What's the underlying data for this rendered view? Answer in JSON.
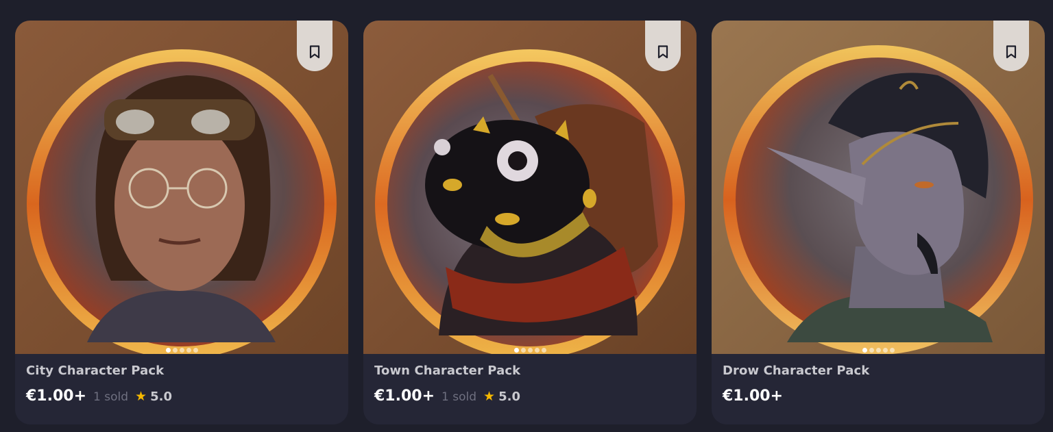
{
  "colors": {
    "page_bg": "#1e1f2b",
    "card_bg": "#252636",
    "bookmark_bg": "#ddd7d2",
    "star": "#f5b800",
    "title": "#c9c9cf",
    "sold": "#6f7080"
  },
  "products": [
    {
      "title": "City Character Pack",
      "price": "€1.00+",
      "sold": "1 sold",
      "rating": "5.0",
      "star_icon": "★",
      "image_subject": "human-with-goggles-and-glasses",
      "carousel_dots": 5,
      "active_dot": 0
    },
    {
      "title": "Town Character Pack",
      "price": "€1.00+",
      "sold": "1 sold",
      "rating": "5.0",
      "star_icon": "★",
      "image_subject": "salamander-with-scarf",
      "carousel_dots": 5,
      "active_dot": 0
    },
    {
      "title": "Drow Character Pack",
      "price": "€1.00+",
      "image_subject": "drow-elf",
      "carousel_dots": 5,
      "active_dot": 0
    }
  ]
}
